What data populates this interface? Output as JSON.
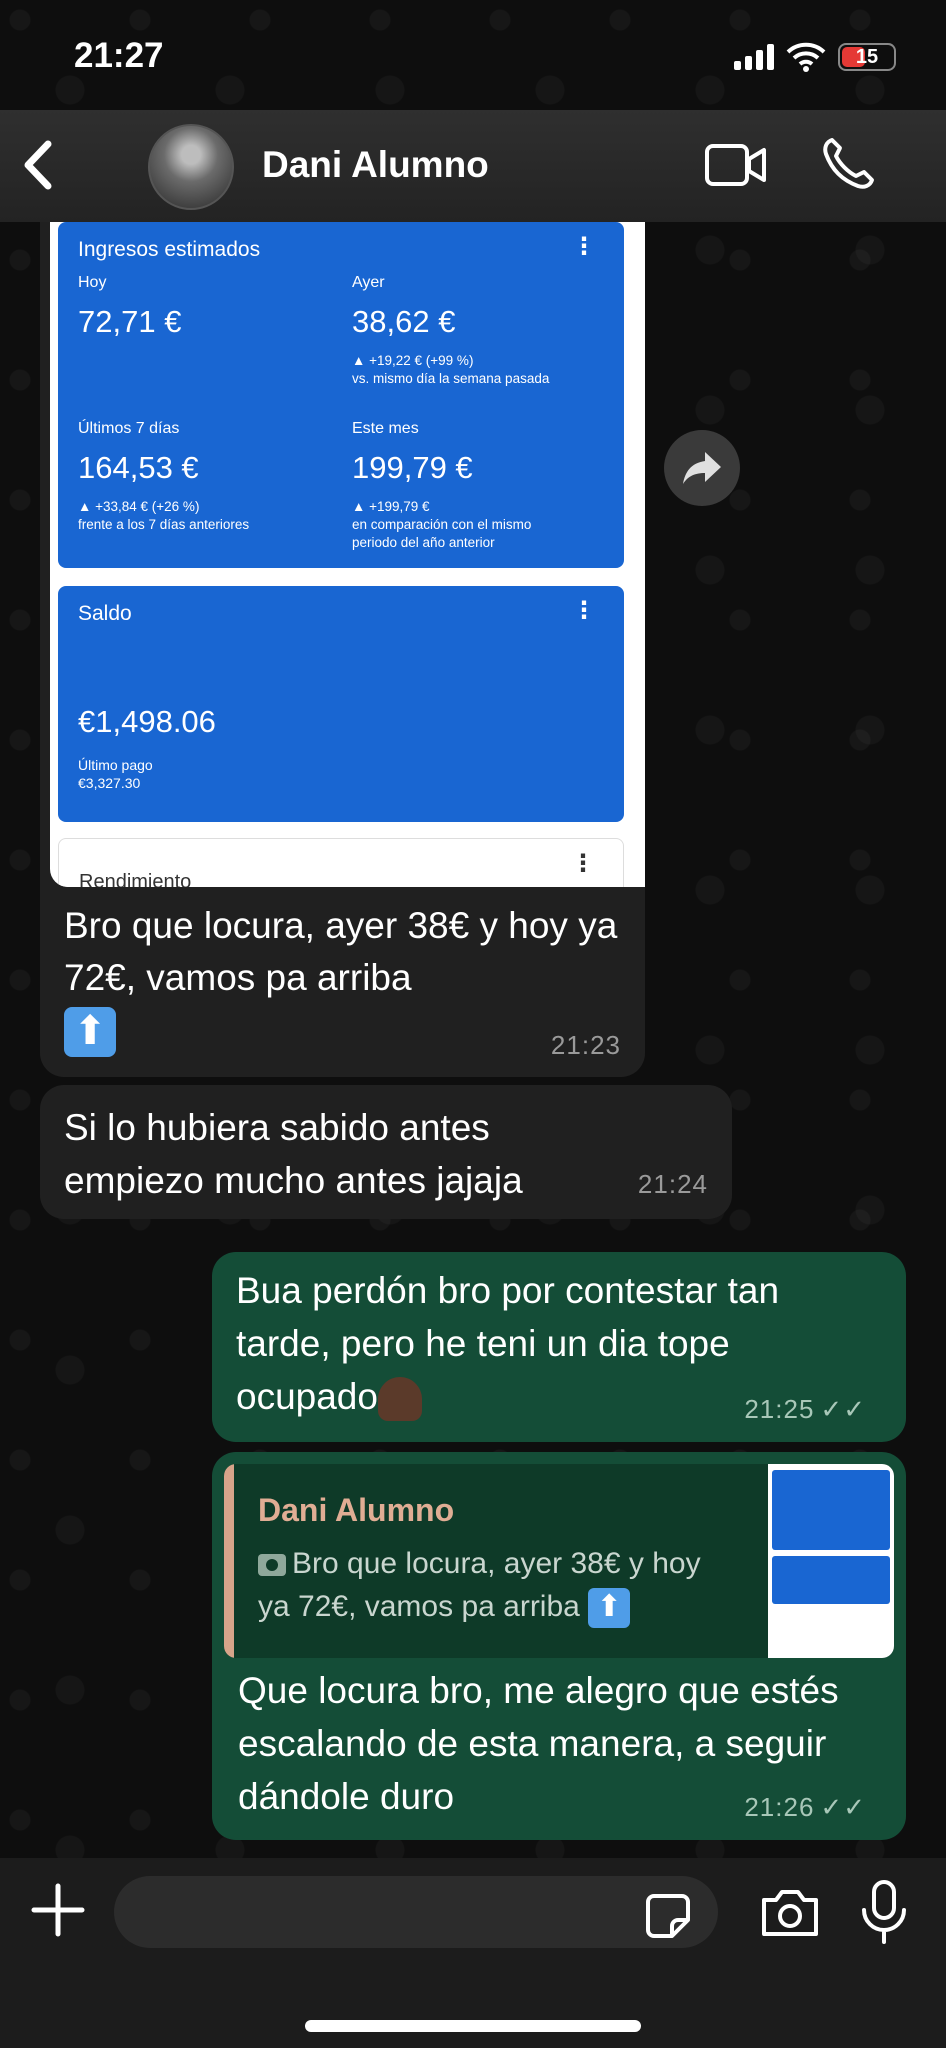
{
  "status_bar": {
    "time": "21:27",
    "battery": "15"
  },
  "header": {
    "contact_name": "Dani Alumno"
  },
  "image_message": {
    "card1": {
      "title": "Ingresos estimados",
      "today_label": "Hoy",
      "today_value": "72,71 €",
      "yesterday_label": "Ayer",
      "yesterday_value": "38,62 €",
      "yesterday_sub1": "▲ +19,22 € (+99 %)",
      "yesterday_sub2": "vs. mismo día la semana pasada",
      "week_label": "Últimos 7 días",
      "week_value": "164,53 €",
      "week_sub1": "▲ +33,84 € (+26 %)",
      "week_sub2": "frente a los 7 días anteriores",
      "month_label": "Este mes",
      "month_value": "199,79 €",
      "month_sub1": "▲ +199,79 €",
      "month_sub2": "en comparación con el mismo",
      "month_sub3": "periodo del año anterior"
    },
    "card2": {
      "title": "Saldo",
      "value": "€1,498.06",
      "sub1": "Último pago",
      "sub2": "€3,327.30"
    },
    "card3": {
      "title": "Rendimiento"
    },
    "caption": "Bro que locura, ayer 38€ y hoy ya 72€, vamos pa arriba",
    "time": "21:23"
  },
  "message2": {
    "text_line1": "Si lo hubiera sabido antes",
    "text_line2": "empiezo mucho antes jajaja",
    "time": "21:24"
  },
  "message3": {
    "text": "Bua perdón bro por contestar tan tarde, pero he teni un dia tope ocupado",
    "time": "21:25"
  },
  "message4": {
    "quote_name": "Dani Alumno",
    "quote_text": "Bro que locura, ayer 38€ y hoy ya 72€, vamos pa arriba",
    "text": "Que locura bro, me alegro que estés escalando de esta manera, a seguir dándole duro",
    "time": "21:26"
  },
  "composer": {
    "placeholder": ""
  },
  "colors": {
    "sent_bubble": "#144d37",
    "received_bubble": "#202020",
    "card_blue": "#1966d2"
  }
}
